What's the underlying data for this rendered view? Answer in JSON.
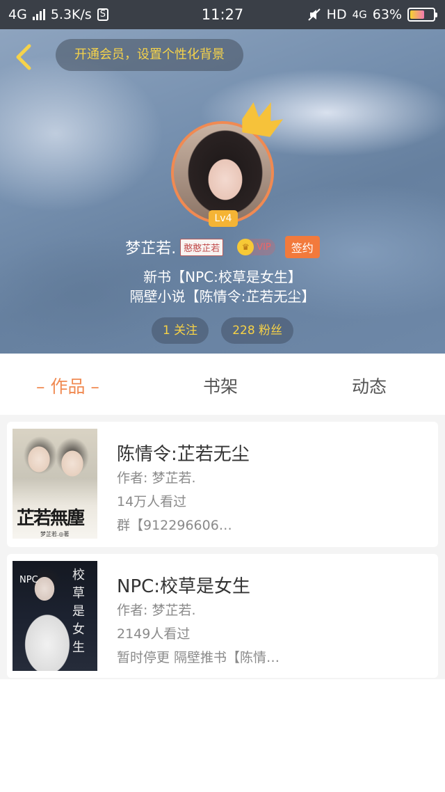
{
  "status_bar": {
    "network": "4G",
    "speed": "5.3K/s",
    "s_icon": "S",
    "time": "11:27",
    "hd": "HD",
    "net_right": "4G",
    "battery": "63%",
    "battery_level": 0.63
  },
  "header": {
    "vip_banner": "开通会员，设置个性化背景",
    "level": "Lv4",
    "username": "梦芷若.",
    "fan_badge": "憨憨芷若",
    "vip_label": "VIP",
    "sign_label": "签约",
    "bio_line1": "新书【NPC:校草是女生】",
    "bio_line2": "隔壁小说【陈情令:芷若无尘】",
    "following": "1 关注",
    "followers": "228 粉丝"
  },
  "tabs": {
    "works": "– 作品 –",
    "shelf": "书架",
    "feed": "动态"
  },
  "books": [
    {
      "title": "陈情令:芷若无尘",
      "author": "作者: 梦芷若.",
      "views": "14万人看过",
      "desc": "群【912296606…",
      "cover_text": "芷若無塵",
      "cover_small": "梦芷若.◎著"
    },
    {
      "title": "NPC:校草是女生",
      "author": "作者: 梦芷若.",
      "views": "2149人看过",
      "desc": "暂时停更 隔壁推书【陈情…",
      "cover_npc": "NPC",
      "cover_vertical": "校草是女生"
    }
  ],
  "colors": {
    "accent": "#f08a52",
    "gold": "#f7d246",
    "sign": "#f27a3c"
  }
}
